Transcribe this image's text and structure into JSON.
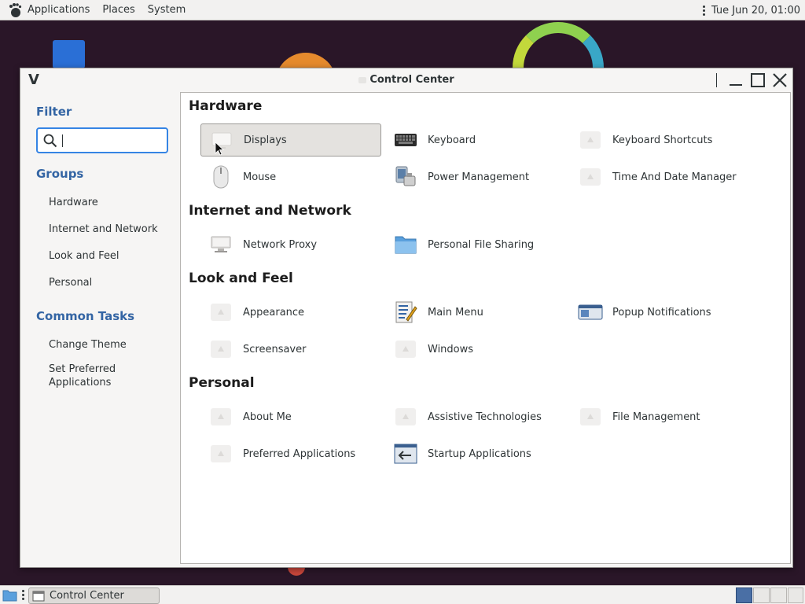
{
  "top_panel": {
    "menus": [
      "Applications",
      "Places",
      "System"
    ],
    "clock": "Tue Jun 20, 01:00"
  },
  "window": {
    "title": "Control Center",
    "logo": "V"
  },
  "sidebar": {
    "filter_heading": "Filter",
    "search_value": "",
    "groups_heading": "Groups",
    "groups": [
      "Hardware",
      "Internet and Network",
      "Look and Feel",
      "Personal"
    ],
    "tasks_heading": "Common Tasks",
    "tasks": [
      "Change Theme",
      "Set Preferred Applications"
    ]
  },
  "content": {
    "groups": [
      {
        "title": "Hardware",
        "items": [
          {
            "label": "Displays",
            "icon": "display-icon",
            "selected": true
          },
          {
            "label": "Keyboard",
            "icon": "keyboard-icon"
          },
          {
            "label": "Keyboard Shortcuts",
            "icon": "placeholder-icon"
          },
          {
            "label": "Mouse",
            "icon": "mouse-icon"
          },
          {
            "label": "Power Management",
            "icon": "power-management-icon"
          },
          {
            "label": "Time And Date Manager",
            "icon": "placeholder-icon"
          }
        ]
      },
      {
        "title": "Internet and Network",
        "items": [
          {
            "label": "Network Proxy",
            "icon": "network-proxy-icon"
          },
          {
            "label": "Personal File Sharing",
            "icon": "folder-share-icon"
          }
        ]
      },
      {
        "title": "Look and Feel",
        "items": [
          {
            "label": "Appearance",
            "icon": "placeholder-icon"
          },
          {
            "label": "Main Menu",
            "icon": "main-menu-icon"
          },
          {
            "label": "Popup Notifications",
            "icon": "popup-notification-icon"
          },
          {
            "label": "Screensaver",
            "icon": "placeholder-icon"
          },
          {
            "label": "Windows",
            "icon": "placeholder-icon"
          }
        ]
      },
      {
        "title": "Personal",
        "items": [
          {
            "label": "About Me",
            "icon": "placeholder-icon"
          },
          {
            "label": "Assistive Technologies",
            "icon": "placeholder-icon"
          },
          {
            "label": "File Management",
            "icon": "placeholder-icon"
          },
          {
            "label": "Preferred Applications",
            "icon": "placeholder-icon"
          },
          {
            "label": "Startup Applications",
            "icon": "startup-applications-icon"
          }
        ]
      }
    ]
  },
  "bottom_panel": {
    "task_label": "Control Center"
  },
  "colors": {
    "accent": "#3584e4",
    "sidebar_heading": "#3465a4",
    "selection_bg": "#e4e2df"
  }
}
